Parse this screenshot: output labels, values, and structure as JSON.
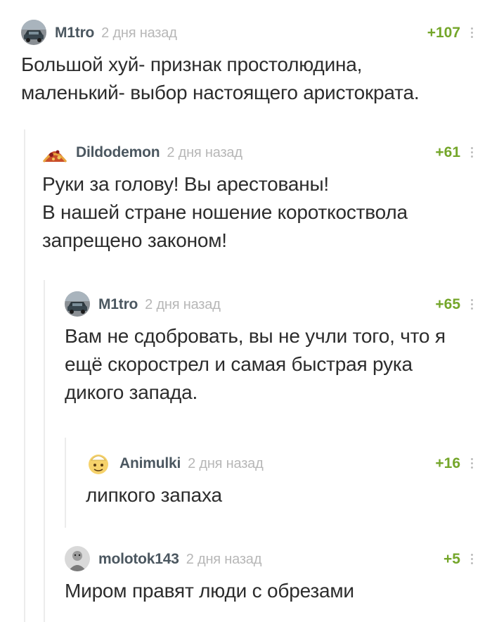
{
  "comments": [
    {
      "author": "M1tro",
      "time": "2 дня назад",
      "rating": "+107",
      "text": "Большой хуй- признак простолюдина,\nмаленький- выбор настоящего аристократа.",
      "avatar": "car-avatar-icon"
    },
    {
      "author": "Dildodemon",
      "time": "2 дня назад",
      "rating": "+61",
      "text": "Руки за голову! Вы арестованы!\nВ нашей стране ношение короткоствола\nзапрещено законом!",
      "avatar": "pizza-avatar-icon"
    },
    {
      "author": "M1tro",
      "time": "2 дня назад",
      "rating": "+65",
      "text": "Вам не сдобровать, вы не учли того, что я\nещё скорострел и самая быстрая рука\nдикого запада.",
      "avatar": "car-avatar-icon"
    },
    {
      "author": "Animulki",
      "time": "2 дня назад",
      "rating": "+16",
      "text": "липкого запаха",
      "avatar": "cartoon-avatar-icon"
    },
    {
      "author": "molotok143",
      "time": "2 дня назад",
      "rating": "+5",
      "text": "Миром правят люди с обрезами",
      "avatar": "person-avatar-icon"
    }
  ]
}
